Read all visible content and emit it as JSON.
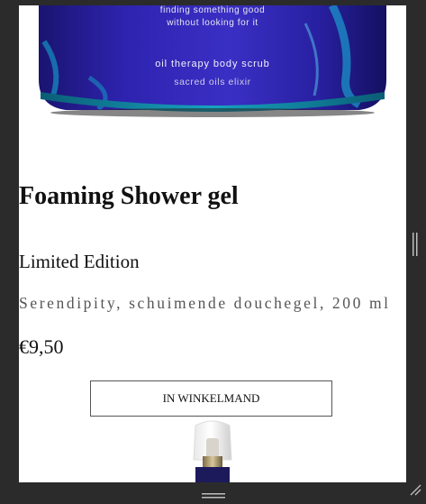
{
  "product": {
    "image_lines": {
      "line1": "finding something good",
      "line2": "without looking for it",
      "name": "oil therapy body scrub",
      "sub": "sacred oils elixir"
    },
    "title": "Foaming Shower gel",
    "edition": "Limited Edition",
    "description": "Serendipity, schuimende douchegel, 200 ml",
    "price": "€9,50",
    "cart_button": "IN WINKELMAND"
  },
  "icons": {
    "scroll": "scroll-handle-icon",
    "grip": "drag-grip-icon",
    "resize": "resize-corner-icon"
  },
  "colors": {
    "jar_blue": "#2a1f9c",
    "teal_rim": "#0e7f9a",
    "background": "#2b2b2b"
  }
}
